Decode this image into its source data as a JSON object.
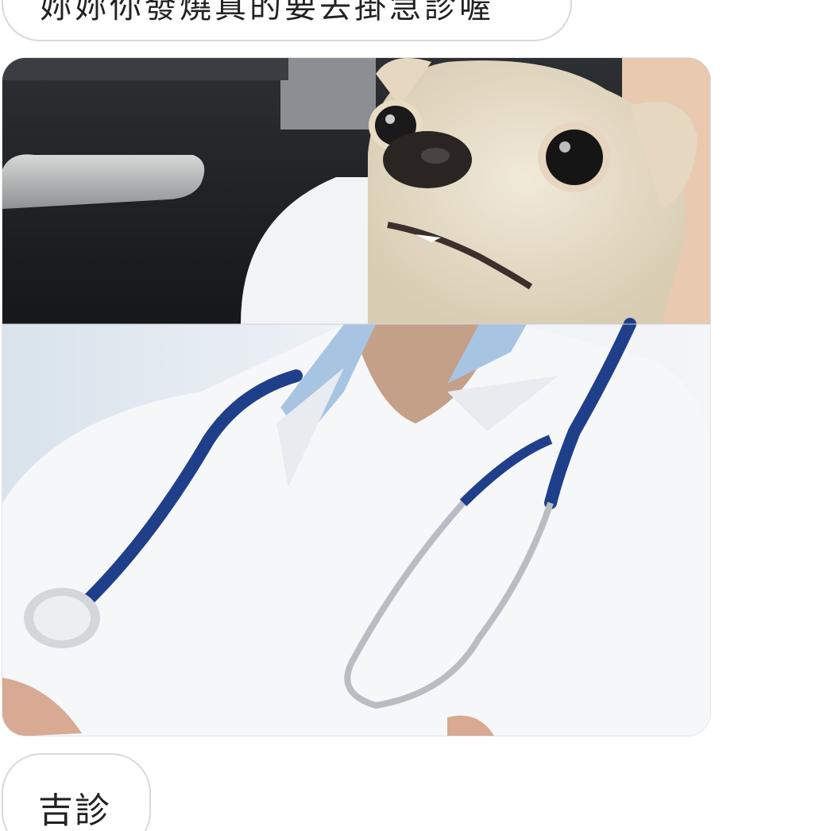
{
  "messages": [
    {
      "text": "妳妳你發燒真的要去掛急診喔"
    },
    {
      "image": "chihuahua-doctor-meme"
    },
    {
      "text": "吉診"
    }
  ],
  "colors": {
    "bubble_border": "#d9d9d9",
    "text": "#222222",
    "stethoscope": "#1f3f8a",
    "coat": "#f4f5f7",
    "dog": "#e8e0cf"
  }
}
